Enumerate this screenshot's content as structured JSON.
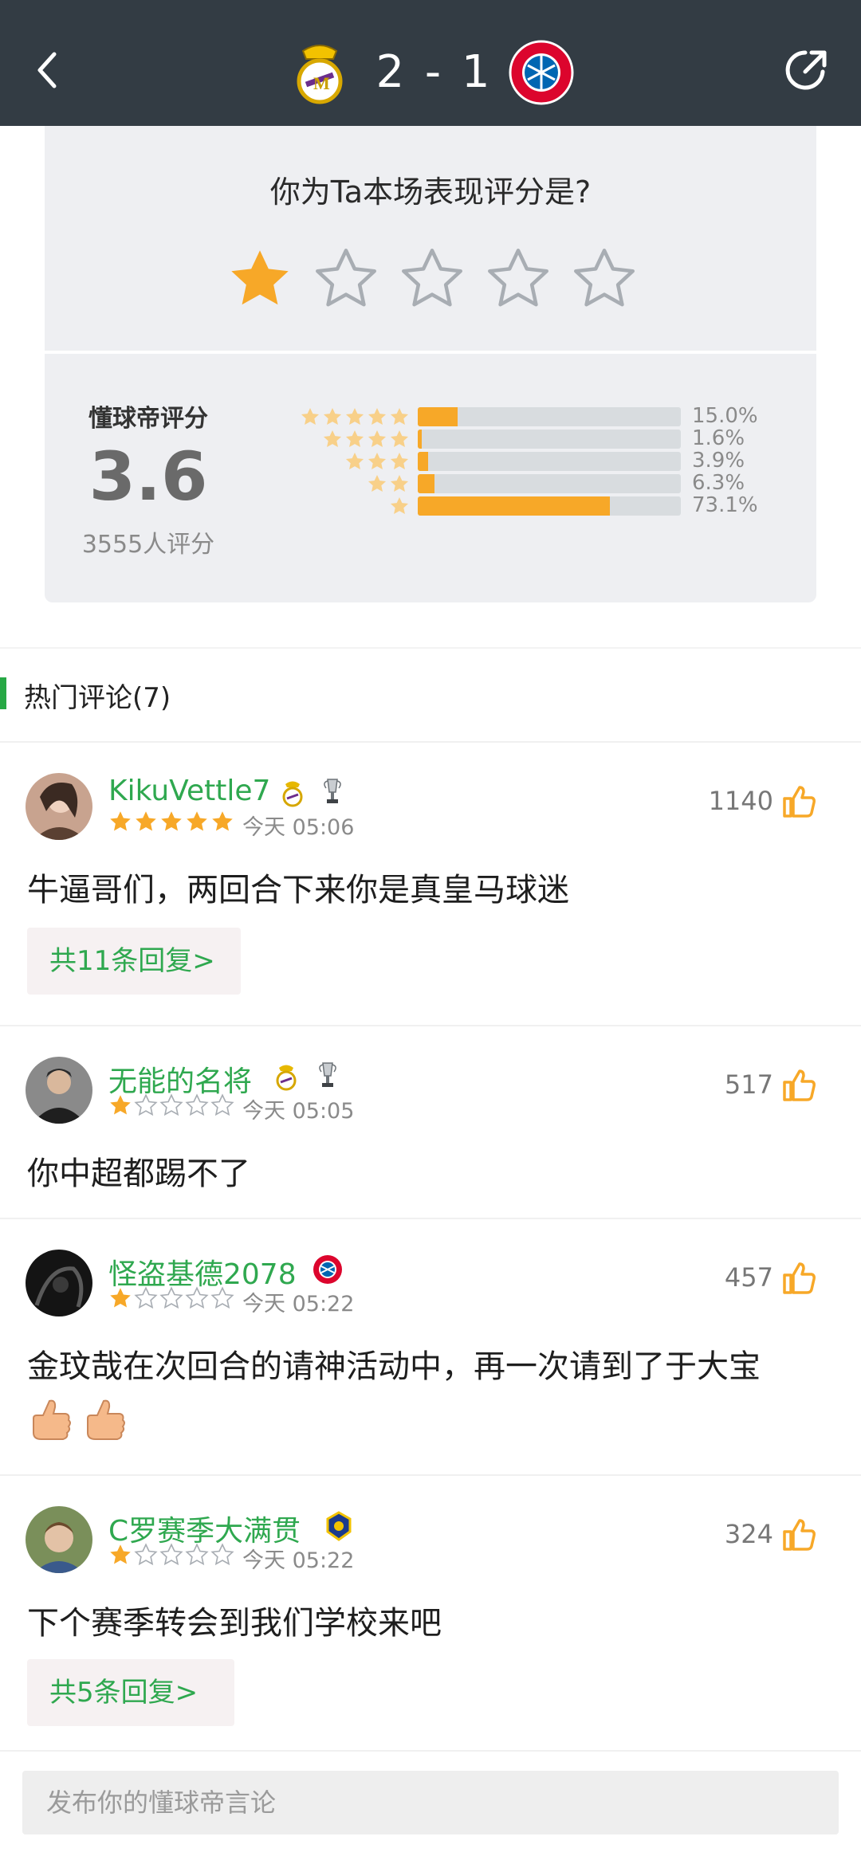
{
  "header": {
    "score": "2 - 1",
    "home_team": "Real Madrid",
    "away_team": "FC Bayern München",
    "colors": {
      "bar": "#333c44",
      "text": "#ffffff"
    },
    "icons": {
      "back": "chevron-left-icon",
      "share": "share-icon"
    }
  },
  "rating": {
    "question": "你为Ta本场表现评分是?",
    "user_rating": 1,
    "max_stars": 5,
    "label": "懂球帝评分",
    "score": "3.6",
    "count_text": "3555人评分",
    "distribution": [
      {
        "stars": 5,
        "pct_text": "15.0%",
        "pct": 15.0
      },
      {
        "stars": 4,
        "pct_text": "1.6%",
        "pct": 1.6
      },
      {
        "stars": 3,
        "pct_text": "3.9%",
        "pct": 3.9
      },
      {
        "stars": 2,
        "pct_text": "6.3%",
        "pct": 6.3
      },
      {
        "stars": 1,
        "pct_text": "73.1%",
        "pct": 73.1
      }
    ],
    "colors": {
      "accent": "#f7a828",
      "track": "#d8dcdf"
    }
  },
  "hot_comments": {
    "title": "热门评论(7)",
    "accent": "#27a845",
    "items": [
      {
        "username": "KikuVettle7",
        "rating": 5,
        "time": "今天 05:06",
        "likes": "1140",
        "text": "牛逼哥们，两回合下来你是真皇马球迷",
        "reply_label": "共11条回复>",
        "badges": [
          "real-madrid-badge-icon",
          "trophy-icon"
        ]
      },
      {
        "username": "无能的名将",
        "rating": 1,
        "time": "今天 05:05",
        "likes": "517",
        "text": "你中超都踢不了",
        "reply_label": "",
        "badges": [
          "real-madrid-badge-icon",
          "trophy-icon"
        ]
      },
      {
        "username": "怪盗基德2078",
        "rating": 1,
        "time": "今天 05:22",
        "likes": "457",
        "text": "金玟哉在次回合的请神活动中，再一次请到了于大宝",
        "reply_label": "",
        "badges": [
          "bayern-badge-icon"
        ]
      },
      {
        "username": "C罗赛季大满贯",
        "rating": 1,
        "time": "今天 05:22",
        "likes": "324",
        "text": "下个赛季转会到我们学校来吧",
        "reply_label": "共5条回复>",
        "badges": [
          "al-nassr-badge-icon"
        ]
      }
    ]
  },
  "bottom": {
    "input_placeholder": "发布你的懂球帝言论"
  }
}
